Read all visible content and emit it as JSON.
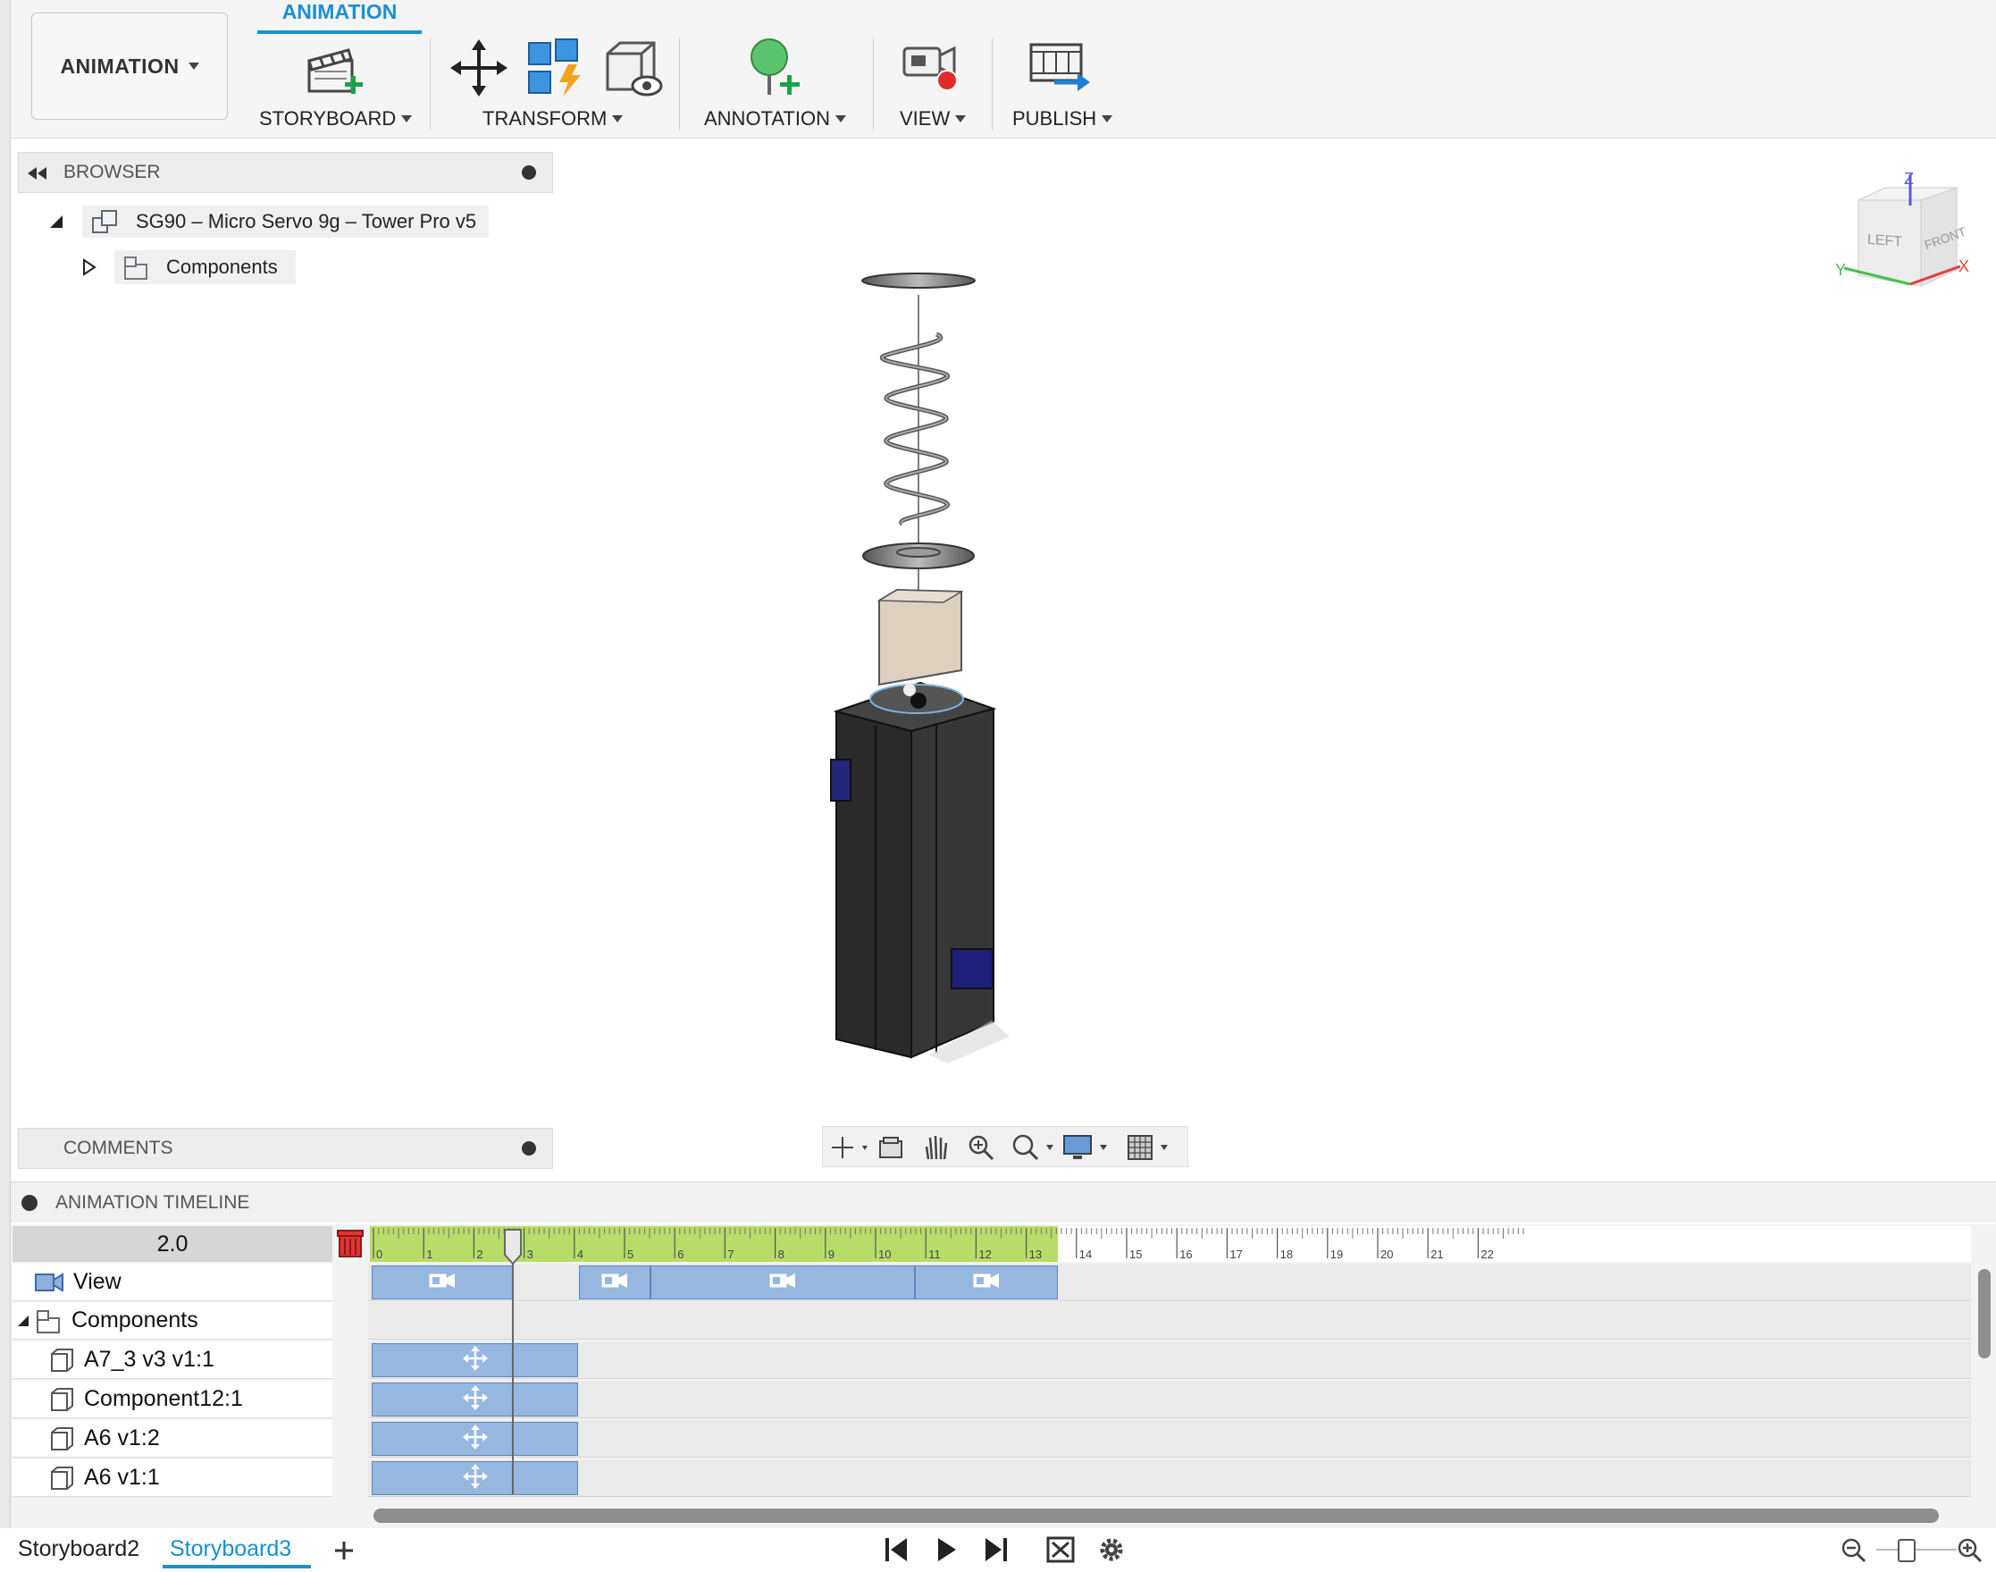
{
  "toolbar": {
    "workspace": "ANIMATION",
    "active_tab": "ANIMATION",
    "groups": {
      "storyboard": "STORYBOARD",
      "transform": "TRANSFORM",
      "annotation": "ANNOTATION",
      "view": "VIEW",
      "publish": "PUBLISH"
    }
  },
  "browser": {
    "title": "BROWSER",
    "root": "SG90 – Micro Servo 9g – Tower Pro v5",
    "child": "Components"
  },
  "comments": {
    "title": "COMMENTS"
  },
  "viewcube": {
    "left": "LEFT",
    "front": "FRONT",
    "axis_z": "Z",
    "axis_x": "X",
    "axis_y": "Y"
  },
  "timeline": {
    "title": "ANIMATION TIMELINE",
    "current_time": "2.0",
    "ruler_labels": [
      "0",
      "1",
      "2",
      "3",
      "4",
      "5",
      "6",
      "7",
      "8",
      "9",
      "10",
      "11",
      "12",
      "13",
      "14",
      "15",
      "16",
      "17",
      "18",
      "19",
      "20",
      "21",
      "22"
    ],
    "tracks": [
      {
        "label": "View"
      },
      {
        "label": "Components"
      },
      {
        "label": "A7_3 v3 v1:1"
      },
      {
        "label": "Component12:1"
      },
      {
        "label": "A6 v1:2"
      },
      {
        "label": "A6 v1:1"
      }
    ]
  },
  "storyboards": {
    "tabs": [
      "Storyboard2",
      "Storyboard3"
    ],
    "active": "Storyboard3"
  },
  "colors": {
    "accent": "#1b8fd1",
    "clip": "#96b7df",
    "ruler_green": "#b7dc68"
  }
}
